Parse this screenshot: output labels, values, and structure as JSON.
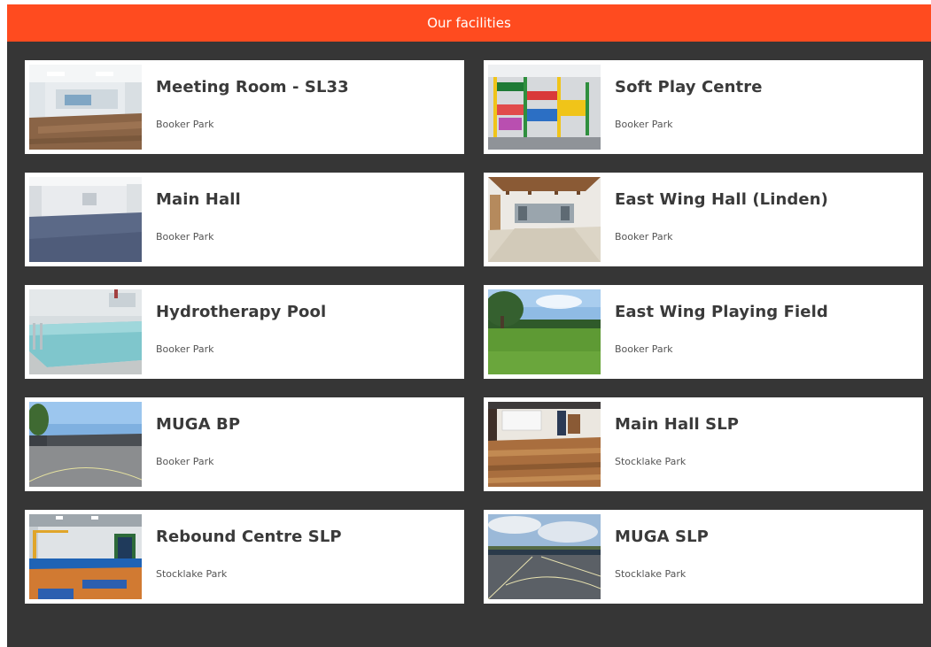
{
  "header": {
    "title": "Our facilities"
  },
  "facilities": [
    {
      "name": "Meeting Room - SL33",
      "location": "Booker Park",
      "thumb_icon": "meeting-room-photo"
    },
    {
      "name": "Soft Play Centre",
      "location": "Booker Park",
      "thumb_icon": "soft-play-photo"
    },
    {
      "name": "Main Hall",
      "location": "Booker Park",
      "thumb_icon": "main-hall-photo"
    },
    {
      "name": "East Wing Hall (Linden)",
      "location": "Booker Park",
      "thumb_icon": "east-wing-hall-photo"
    },
    {
      "name": "Hydrotherapy Pool",
      "location": "Booker Park",
      "thumb_icon": "pool-photo"
    },
    {
      "name": "East Wing Playing Field",
      "location": "Booker Park",
      "thumb_icon": "playing-field-photo"
    },
    {
      "name": "MUGA BP",
      "location": "Booker Park",
      "thumb_icon": "muga-bp-photo"
    },
    {
      "name": "Main Hall SLP",
      "location": "Stocklake Park",
      "thumb_icon": "main-hall-slp-photo"
    },
    {
      "name": "Rebound Centre SLP",
      "location": "Stocklake Park",
      "thumb_icon": "rebound-centre-photo"
    },
    {
      "name": "MUGA SLP",
      "location": "Stocklake Park",
      "thumb_icon": "muga-slp-photo"
    }
  ],
  "colors": {
    "header_bg": "#ff4b1f",
    "panel_bg": "#363636",
    "card_bg": "#ffffff",
    "title_text": "#3a3a3a"
  }
}
